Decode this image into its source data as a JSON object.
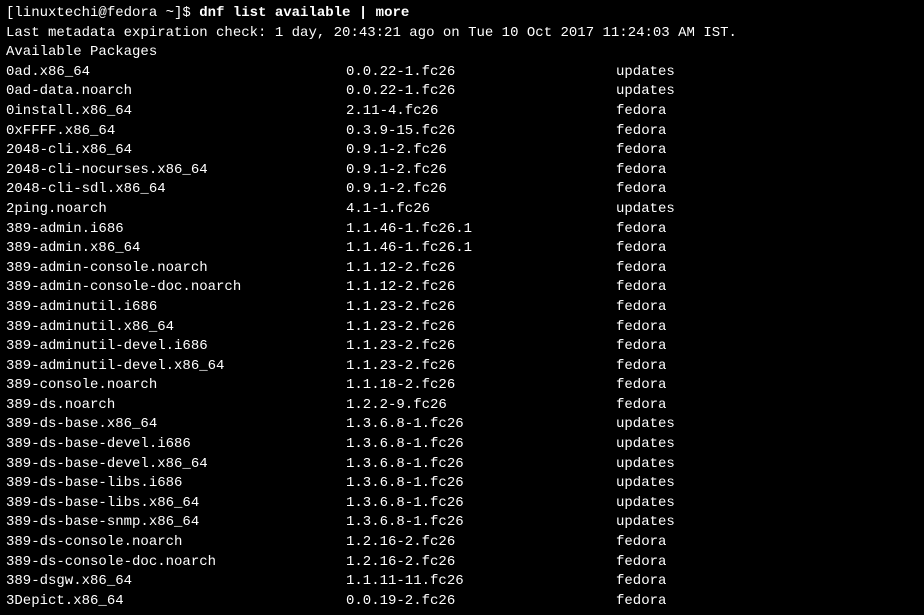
{
  "prompt": "[linuxtechi@fedora ~]$ ",
  "command": "dnf list available | more",
  "info_line": "Last metadata expiration check: 1 day, 20:43:21 ago on Tue 10 Oct 2017 11:24:03 AM IST.",
  "header": "Available Packages",
  "packages": [
    {
      "name": "0ad.x86_64",
      "version": "0.0.22-1.fc26",
      "repo": "updates"
    },
    {
      "name": "0ad-data.noarch",
      "version": "0.0.22-1.fc26",
      "repo": "updates"
    },
    {
      "name": "0install.x86_64",
      "version": "2.11-4.fc26",
      "repo": "fedora"
    },
    {
      "name": "0xFFFF.x86_64",
      "version": "0.3.9-15.fc26",
      "repo": "fedora"
    },
    {
      "name": "2048-cli.x86_64",
      "version": "0.9.1-2.fc26",
      "repo": "fedora"
    },
    {
      "name": "2048-cli-nocurses.x86_64",
      "version": "0.9.1-2.fc26",
      "repo": "fedora"
    },
    {
      "name": "2048-cli-sdl.x86_64",
      "version": "0.9.1-2.fc26",
      "repo": "fedora"
    },
    {
      "name": "2ping.noarch",
      "version": "4.1-1.fc26",
      "repo": "updates"
    },
    {
      "name": "389-admin.i686",
      "version": "1.1.46-1.fc26.1",
      "repo": "fedora"
    },
    {
      "name": "389-admin.x86_64",
      "version": "1.1.46-1.fc26.1",
      "repo": "fedora"
    },
    {
      "name": "389-admin-console.noarch",
      "version": "1.1.12-2.fc26",
      "repo": "fedora"
    },
    {
      "name": "389-admin-console-doc.noarch",
      "version": "1.1.12-2.fc26",
      "repo": "fedora"
    },
    {
      "name": "389-adminutil.i686",
      "version": "1.1.23-2.fc26",
      "repo": "fedora"
    },
    {
      "name": "389-adminutil.x86_64",
      "version": "1.1.23-2.fc26",
      "repo": "fedora"
    },
    {
      "name": "389-adminutil-devel.i686",
      "version": "1.1.23-2.fc26",
      "repo": "fedora"
    },
    {
      "name": "389-adminutil-devel.x86_64",
      "version": "1.1.23-2.fc26",
      "repo": "fedora"
    },
    {
      "name": "389-console.noarch",
      "version": "1.1.18-2.fc26",
      "repo": "fedora"
    },
    {
      "name": "389-ds.noarch",
      "version": "1.2.2-9.fc26",
      "repo": "fedora"
    },
    {
      "name": "389-ds-base.x86_64",
      "version": "1.3.6.8-1.fc26",
      "repo": "updates"
    },
    {
      "name": "389-ds-base-devel.i686",
      "version": "1.3.6.8-1.fc26",
      "repo": "updates"
    },
    {
      "name": "389-ds-base-devel.x86_64",
      "version": "1.3.6.8-1.fc26",
      "repo": "updates"
    },
    {
      "name": "389-ds-base-libs.i686",
      "version": "1.3.6.8-1.fc26",
      "repo": "updates"
    },
    {
      "name": "389-ds-base-libs.x86_64",
      "version": "1.3.6.8-1.fc26",
      "repo": "updates"
    },
    {
      "name": "389-ds-base-snmp.x86_64",
      "version": "1.3.6.8-1.fc26",
      "repo": "updates"
    },
    {
      "name": "389-ds-console.noarch",
      "version": "1.2.16-2.fc26",
      "repo": "fedora"
    },
    {
      "name": "389-ds-console-doc.noarch",
      "version": "1.2.16-2.fc26",
      "repo": "fedora"
    },
    {
      "name": "389-dsgw.x86_64",
      "version": "1.1.11-11.fc26",
      "repo": "fedora"
    },
    {
      "name": "3Depict.x86_64",
      "version": "0.0.19-2.fc26",
      "repo": "fedora"
    }
  ]
}
